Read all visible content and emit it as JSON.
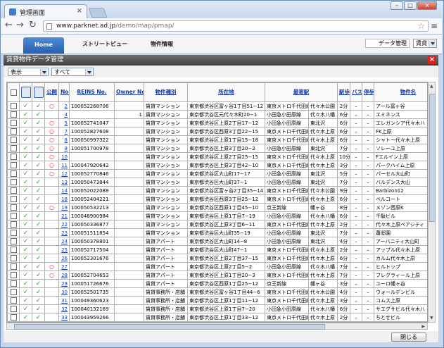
{
  "browser": {
    "tab_title": "管理画面",
    "tab_close": "×",
    "url_host": "www.parknet.ad.jp",
    "url_path": "/demo/map/pmap/",
    "win_min": "–",
    "win_max": "□",
    "win_close": "×"
  },
  "sitenav": {
    "home": "Home",
    "street_view": "ストリートビュー",
    "property_info": "物件情報",
    "data_mgmt": "データ管理",
    "data_mgmt_select": "賃貸"
  },
  "panel": {
    "title": "賃貸物件データ管理",
    "close": "×",
    "filter_label": "表示",
    "filter_value": "すべて",
    "close_button": "閉じる"
  },
  "columns": {
    "publish": "公開",
    "no": "No.",
    "reins": "REINS No.",
    "owner": "Owner No.",
    "type": "物件種別",
    "address": "所在地",
    "station": "最寄駅",
    "walk": "駅歩",
    "bus": "バス",
    "stop": "停歩",
    "name": "物件名"
  },
  "icons": {
    "tick": "✓",
    "circle": "○",
    "dash": "–"
  },
  "rows": [
    {
      "c1": "✓",
      "c2": "✓",
      "pub": "○",
      "no": "2",
      "reins": "100052268706",
      "owner": "",
      "type": "賃貸マンション",
      "addr": "東京都渋谷区富ヶ谷1丁目51−12",
      "line": "東京メトロ千代田線",
      "st": "代々木公園",
      "walk": "2分",
      "bus": "–",
      "stop": "–",
      "name": "アール富ヶ谷"
    },
    {
      "c1": "✓",
      "c2": "✓",
      "pub": "",
      "no": "4",
      "reins": "",
      "owner": "1",
      "type": "賃貸マンション",
      "addr": "東京都渋谷区元代々木町20−1",
      "line": "小田急小田原線",
      "st": "代々木八幡",
      "walk": "6分",
      "bus": "–",
      "stop": "–",
      "name": "エミネンス"
    },
    {
      "c1": "✓",
      "c2": "✓",
      "pub": "○",
      "no": "5",
      "reins": "100052741047",
      "owner": "",
      "type": "賃貸マンション",
      "addr": "東京都渋谷区上原2丁目17−12",
      "line": "小田急小田原線",
      "st": "東北沢",
      "walk": "6分",
      "bus": "–",
      "stop": "–",
      "name": "エレガンシア代々木ハ"
    },
    {
      "c1": "✓",
      "c2": "✓",
      "pub": "○",
      "no": "7",
      "reins": "100052827608",
      "owner": "",
      "type": "賃貸マンション",
      "addr": "東京都渋谷区西原3丁目22−15",
      "line": "東京メトロ千代田線",
      "st": "代々木上原",
      "walk": "6分",
      "bus": "–",
      "stop": "–",
      "name": "FK上原"
    },
    {
      "c1": "✓",
      "c2": "✓",
      "pub": "○",
      "no": "8",
      "reins": "100050997322",
      "owner": "",
      "type": "賃貸マンション",
      "addr": "東京都渋谷区上原1丁目15−18",
      "line": "東京メトロ千代田線",
      "st": "代々木上原",
      "walk": "6分",
      "bus": "–",
      "stop": "–",
      "name": "シャトー代々木上原"
    },
    {
      "c1": "✓",
      "c2": "✓",
      "pub": "○",
      "no": "9",
      "reins": "100051700978",
      "owner": "",
      "type": "賃貸マンション",
      "addr": "東京都渋谷区上原3丁目20−2",
      "line": "小田急小田原線",
      "st": "東北沢",
      "walk": "7分",
      "bus": "–",
      "stop": "–",
      "name": "ソレーユ上原"
    },
    {
      "c1": "✓",
      "c2": "✓",
      "pub": "○",
      "no": "10",
      "reins": "",
      "owner": "",
      "type": "賃貸マンション",
      "addr": "東京都渋谷区上原2丁目25−15",
      "line": "東京メトロ千代田線",
      "st": "代々木上原",
      "walk": "10分",
      "bus": "–",
      "stop": "–",
      "name": "Fエルイン上原"
    },
    {
      "c1": "✓",
      "c2": "✓",
      "pub": "○",
      "no": "11",
      "reins": "100047920642",
      "owner": "",
      "type": "賃貸マンション",
      "addr": "東京都渋谷区上原3丁目42−10",
      "line": "東京メトロ千代田線",
      "st": "代々木上原",
      "walk": "3分",
      "bus": "–",
      "stop": "–",
      "name": "パークハイム上原"
    },
    {
      "c1": "✓",
      "c2": "✓",
      "pub": "○",
      "no": "12",
      "reins": "100052770846",
      "owner": "",
      "type": "賃貸マンション",
      "addr": "東京都渋谷区大山町17−17",
      "line": "小田急小田原線",
      "st": "東北沢",
      "walk": "5分",
      "bus": "–",
      "stop": "–",
      "name": "パーセル大山町"
    },
    {
      "c1": "✓",
      "c2": "✓",
      "pub": "",
      "no": "13",
      "reins": "100050473844",
      "owner": "",
      "type": "賃貸マンション",
      "addr": "東京都渋谷区大山町37−1",
      "line": "小田急小田原線",
      "st": "東北沢",
      "walk": "7分",
      "bus": "–",
      "stop": "–",
      "name": "バルデンス大山"
    },
    {
      "c1": "✓",
      "c2": "✓",
      "pub": "",
      "no": "14",
      "reins": "100052022088",
      "owner": "",
      "type": "賃貸マンション",
      "addr": "東京都渋谷区富ヶ谷2丁目35−14",
      "line": "東京メトロ千代田線",
      "st": "代々木公園",
      "walk": "9分",
      "bus": "–",
      "stop": "–",
      "name": "Barbizon12"
    },
    {
      "c1": "✓",
      "c2": "✓",
      "pub": "",
      "no": "18",
      "reins": "100052404221",
      "owner": "",
      "type": "賃貸マンション",
      "addr": "東京都渋谷区西原3丁目25−12",
      "line": "東京メトロ千代田線",
      "st": "代々木上原",
      "walk": "6分",
      "bus": "–",
      "stop": "–",
      "name": "ベルコート"
    },
    {
      "c1": "✓",
      "c2": "✓",
      "pub": "○",
      "no": "19",
      "reins": "100050532213",
      "owner": "",
      "type": "賃貸マンション",
      "addr": "東京都渋谷区西原1丁目45−10",
      "line": "京王新線",
      "st": "幡ヶ谷",
      "walk": "8分",
      "bus": "–",
      "stop": "–",
      "name": "メゾン西原K"
    },
    {
      "c1": "✓",
      "c2": "✓",
      "pub": "",
      "no": "21",
      "reins": "100048900984",
      "owner": "",
      "type": "賃貸マンション",
      "addr": "東京都渋谷区上原1丁目7−19",
      "line": "小田急小田原線",
      "st": "代々木八幡",
      "walk": "6分",
      "bus": "–",
      "stop": "–",
      "name": "千駄ビル"
    },
    {
      "c1": "✓",
      "c2": "✓",
      "pub": "",
      "no": "22",
      "reins": "100050336877",
      "owner": "",
      "type": "賃貸マンション",
      "addr": "東京都渋谷区上原3丁目6−11",
      "line": "東京メトロ千代田線",
      "st": "代々木上原",
      "walk": "2分",
      "bus": "–",
      "stop": "–",
      "name": "代々木上原ペアシティ"
    },
    {
      "c1": "✓",
      "c2": "✓",
      "pub": "",
      "no": "23",
      "reins": "100051511854",
      "owner": "",
      "type": "賃貸マンション",
      "addr": "東京都渋谷区大山町35−19",
      "line": "小田急小田原線",
      "st": "東北沢",
      "walk": "7分",
      "bus": "–",
      "stop": "–",
      "name": "蕭邸園"
    },
    {
      "c1": "✓",
      "c2": "✓",
      "pub": "",
      "no": "24",
      "reins": "100050378801",
      "owner": "",
      "type": "賃貸アパート",
      "addr": "東京都渋谷区大山町14−8",
      "line": "小田急小田原線",
      "st": "東北沢",
      "walk": "4分",
      "bus": "–",
      "stop": "–",
      "name": "アーバニティ大山町"
    },
    {
      "c1": "✓",
      "c2": "✓",
      "pub": "",
      "no": "25",
      "reins": "100052717504",
      "owner": "",
      "type": "賃貸アパート",
      "addr": "東京都渋谷区大山町47−1",
      "line": "東京メトロ千代田線",
      "st": "代々木上原",
      "walk": "2分",
      "bus": "–",
      "stop": "–",
      "name": "アップル代々木上原"
    },
    {
      "c1": "✓",
      "c2": "✓",
      "pub": "",
      "no": "26",
      "reins": "100052301676",
      "owner": "",
      "type": "賃貸アパート",
      "addr": "東京都渋谷区上原2丁目37−15",
      "line": "東京メトロ千代田線",
      "st": "代々木上原",
      "walk": "6分",
      "bus": "–",
      "stop": "–",
      "name": "カルム代々木上原"
    },
    {
      "c1": "✓",
      "c2": "✓",
      "pub": "○",
      "no": "27",
      "reins": "",
      "owner": "",
      "type": "賃貸アパート",
      "addr": "東京都渋谷区上原2丁目5−2",
      "line": "小田急小田原線",
      "st": "代々木八幡",
      "walk": "7分",
      "bus": "–",
      "stop": "–",
      "name": "ヒルトップ"
    },
    {
      "c1": "✓",
      "c2": "✓",
      "pub": "○",
      "no": "28",
      "reins": "100052704653",
      "owner": "",
      "type": "賃貸アパート",
      "addr": "東京都渋谷区上原1丁目20−3",
      "line": "東京メトロ千代田線",
      "st": "代々木上原",
      "walk": "7分",
      "bus": "–",
      "stop": "–",
      "name": "フレグラィール上原"
    },
    {
      "c1": "✓",
      "c2": "✓",
      "pub": "",
      "no": "29",
      "reins": "100051726676",
      "owner": "",
      "type": "賃貸アパート",
      "addr": "東京都渋谷区西原1丁目25−12",
      "line": "京王新線",
      "st": "幡ヶ谷",
      "walk": "3分",
      "bus": "–",
      "stop": "–",
      "name": "ユーロ幡ヶ谷"
    },
    {
      "c1": "✓",
      "c2": "✓",
      "pub": "",
      "no": "30",
      "reins": "100052501735",
      "owner": "",
      "type": "賃貸事務所・店舗",
      "addr": "東京都渋谷区富ヶ谷1丁目44−6",
      "line": "東京メトロ千代田線",
      "st": "代々木公園",
      "walk": "4分",
      "bus": "–",
      "stop": "–",
      "name": "ウォールデンビル"
    },
    {
      "c1": "✓",
      "c2": "✓",
      "pub": "",
      "no": "31",
      "reins": "100049360623",
      "owner": "",
      "type": "賃貸事務所・店舗",
      "addr": "東京都渋谷区上原1丁目11−12",
      "line": "東京メトロ千代田線",
      "st": "代々木上原",
      "walk": "3分",
      "bus": "–",
      "stop": "–",
      "name": "コムス上原"
    },
    {
      "c1": "✓",
      "c2": "✓",
      "pub": "",
      "no": "32",
      "reins": "100040132169",
      "owner": "",
      "type": "賃貸事務所・店舗",
      "addr": "東京都渋谷区上原1丁目7−20",
      "line": "小田急小田原線",
      "st": "代々木八幡",
      "walk": "6分",
      "bus": "–",
      "stop": "–",
      "name": "サエグサビル代々木八"
    },
    {
      "c1": "✓",
      "c2": "✓",
      "pub": "",
      "no": "33",
      "reins": "100043959266",
      "owner": "",
      "type": "賃貸事務所・店舗",
      "addr": "東京都渋谷区上原1丁目33−12",
      "line": "東京メトロ千代田線",
      "st": "代々木上原",
      "walk": "2分",
      "bus": "–",
      "stop": "–",
      "name": "ちとせビル"
    }
  ]
}
